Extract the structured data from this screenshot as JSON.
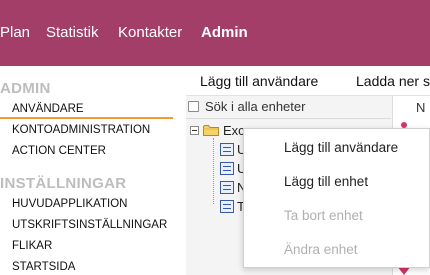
{
  "topnav": {
    "items": [
      {
        "label": "Plan",
        "active": false
      },
      {
        "label": "Statistik",
        "active": false
      },
      {
        "label": "Kontakter",
        "active": false
      },
      {
        "label": "Admin",
        "active": true
      }
    ],
    "background": "#a23e67"
  },
  "sidebar": {
    "admin_heading": "ADMIN",
    "admin_items": [
      {
        "label": "ANVÄNDARE",
        "selected": true
      },
      {
        "label": "KONTOADMINISTRATION",
        "selected": false
      },
      {
        "label": "ACTION CENTER",
        "selected": false
      }
    ],
    "settings_heading": "INSTÄLLNINGAR",
    "settings_items": [
      {
        "label": "HUVUDAPPLIKATION"
      },
      {
        "label": "UTSKRIFTSINSTÄLLNINGAR"
      },
      {
        "label": "FLIKAR"
      },
      {
        "label": "STARTSIDA"
      }
    ],
    "selected_underline_color": "#f39a35"
  },
  "toolbar": {
    "add_user": "Lägg till användare",
    "download": "Ladda ner s"
  },
  "search": {
    "checkbox_label": "Sök i alla enheter",
    "checked": false
  },
  "right_column": {
    "header_fragment": "N"
  },
  "tree": {
    "root_label": "Exc",
    "root_icon": "folder-icon",
    "children": [
      {
        "label": "U",
        "icon": "unit-icon"
      },
      {
        "label": "U",
        "icon": "unit-icon"
      },
      {
        "label": "N",
        "icon": "unit-icon"
      },
      {
        "label": "T",
        "icon": "unit-icon"
      }
    ]
  },
  "context_menu": {
    "items": [
      {
        "label": "Lägg till användare",
        "enabled": true
      },
      {
        "label": "Lägg till enhet",
        "enabled": true
      },
      {
        "label": "Ta bort enhet",
        "enabled": false
      },
      {
        "label": "Ändra enhet",
        "enabled": false
      }
    ]
  }
}
